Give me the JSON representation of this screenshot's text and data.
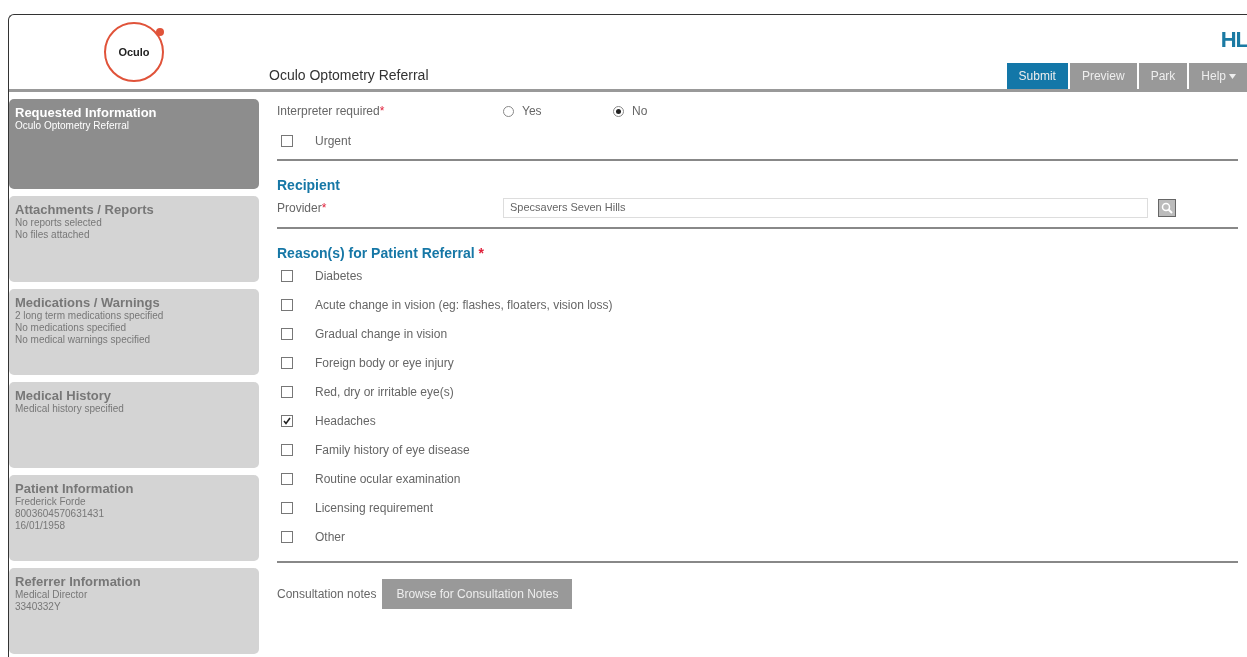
{
  "logo": {
    "text": "Oculo"
  },
  "brand": {
    "text": "HL"
  },
  "form_title": "Oculo Optometry Referral",
  "actions": [
    {
      "label": "Submit",
      "selected": true
    },
    {
      "label": "Preview",
      "selected": false
    },
    {
      "label": "Park",
      "selected": false
    },
    {
      "label": "Help",
      "selected": false,
      "dropdown": true
    }
  ],
  "sidebar": {
    "items": [
      {
        "title": "Requested Information",
        "lines": [
          "Oculo Optometry Referral"
        ],
        "selected": true
      },
      {
        "title": "Attachments / Reports",
        "lines": [
          "No reports selected",
          "No files attached"
        ],
        "selected": false
      },
      {
        "title": "Medications / Warnings",
        "lines": [
          "2 long term medications specified",
          "No medications specified",
          "No medical warnings specified"
        ],
        "selected": false
      },
      {
        "title": "Medical History",
        "lines": [
          "Medical history specified"
        ],
        "selected": false
      },
      {
        "title": "Patient Information",
        "lines": [
          "Frederick Forde",
          "8003604570631431",
          "16/01/1958"
        ],
        "selected": false
      },
      {
        "title": "Referrer Information",
        "lines": [
          "Medical Director",
          "3340332Y"
        ],
        "selected": false
      }
    ]
  },
  "interpreter": {
    "label": "Interpreter required",
    "required_mark": "*",
    "options": [
      {
        "label": "Yes",
        "selected": false
      },
      {
        "label": "No",
        "selected": true
      }
    ]
  },
  "urgent": {
    "label": "Urgent",
    "checked": false
  },
  "recipient": {
    "heading": "Recipient",
    "provider_label": "Provider",
    "required_mark": "*",
    "provider_value": "Specsavers Seven Hills"
  },
  "reasons": {
    "heading": "Reason(s) for Patient Referral",
    "required_mark": "*",
    "items": [
      {
        "label": "Diabetes",
        "checked": false
      },
      {
        "label": "Acute change in vision (eg: flashes, floaters, vision loss)",
        "checked": false
      },
      {
        "label": "Gradual change in vision",
        "checked": false
      },
      {
        "label": "Foreign body or eye injury",
        "checked": false
      },
      {
        "label": "Red, dry or irritable eye(s)",
        "checked": false
      },
      {
        "label": "Headaches",
        "checked": true
      },
      {
        "label": "Family history of eye disease",
        "checked": false
      },
      {
        "label": "Routine ocular examination",
        "checked": false
      },
      {
        "label": "Licensing requirement",
        "checked": false
      },
      {
        "label": "Other",
        "checked": false
      }
    ]
  },
  "consultation": {
    "label": "Consultation notes",
    "button": "Browse for Consultation Notes"
  }
}
